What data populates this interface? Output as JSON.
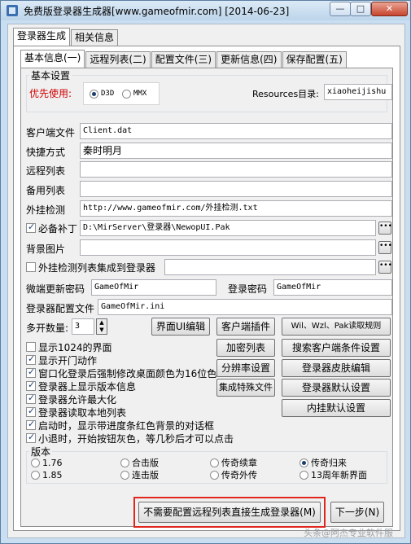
{
  "window": {
    "title": "免费版登录器生成器[www.gameofmir.com] [2014-06-23]",
    "min": "—",
    "max": "□",
    "close": "✕"
  },
  "outer_tabs": [
    "登录器生成",
    "相关信息"
  ],
  "inner_tabs": [
    "基本信息(一)",
    "远程列表(二)",
    "配置文件(三)",
    "更新信息(四)",
    "保存配置(五)"
  ],
  "basic": {
    "group_title": "基本设置",
    "priority_label": "优先使用:",
    "d3d": "D3D",
    "mmx": "MMX",
    "resources_label": "Resources目录:",
    "resources_value": "xiaoheijishu"
  },
  "fields": {
    "client_file_label": "客户端文件",
    "client_file_value": "Client.dat",
    "shortcut_label": "快捷方式",
    "shortcut_value": "秦时明月",
    "remote_list_label": "远程列表",
    "remote_list_value": "",
    "backup_list_label": "备用列表",
    "backup_list_value": "",
    "plugin_check_label": "外挂检测",
    "plugin_check_value": "http://www.gameofmir.com/外挂检测.txt",
    "patch_label": "必备补丁",
    "patch_value": "D:\\MirServer\\登录器\\NewopUI.Pak",
    "bg_label": "背景图片",
    "bg_value": "",
    "integrate_label": "外挂检测列表集成到登录器",
    "integrate_value": "",
    "micro_pw_label": "微端更新密码",
    "micro_pw_value": "GameOfMir",
    "login_pw_label": "登录密码",
    "login_pw_value": "GameOfMir",
    "config_file_label": "登录器配置文件",
    "config_file_value": "GameOfMir.ini",
    "multi_label": "多开数量:",
    "multi_value": "3"
  },
  "buttons": {
    "ui_edit": "界面UI编辑",
    "client_plugin": "客户端插件",
    "wil_rule": "Wil、Wzl、Pak读取规则",
    "encrypt_list": "加密列表",
    "search_client": "搜索客户端条件设置",
    "resolution": "分辨率设置",
    "skin_edit": "登录器皮肤编辑",
    "integrate_special": "集成特殊文件",
    "login_default": "登录器默认设置",
    "inner_default": "内挂默认设置",
    "generate_direct": "不需要配置远程列表直接生成登录器(M)",
    "next": "下一步(N)"
  },
  "options": [
    {
      "label": "显示1024的界面",
      "checked": false
    },
    {
      "label": "显示开门动作",
      "checked": true
    },
    {
      "label": "窗口化登录后强制修改桌面颜色为16位色",
      "checked": true
    },
    {
      "label": "登录器上显示版本信息",
      "checked": true
    },
    {
      "label": "登录器允许最大化",
      "checked": true
    },
    {
      "label": "登录器读取本地列表",
      "checked": true
    },
    {
      "label": "启动时，显示带进度条红色背景的对话框",
      "checked": true
    },
    {
      "label": "小退时，开始按钮灰色，等几秒后才可以点击",
      "checked": true
    }
  ],
  "version": {
    "title": "版本",
    "items": [
      "1.76",
      "1.85",
      "合击版",
      "连击版",
      "传奇续章",
      "传奇外传",
      "传奇归来",
      "13周年新界面"
    ],
    "selected": "传奇归来"
  },
  "watermark": "头条@阿杰专业软件服"
}
